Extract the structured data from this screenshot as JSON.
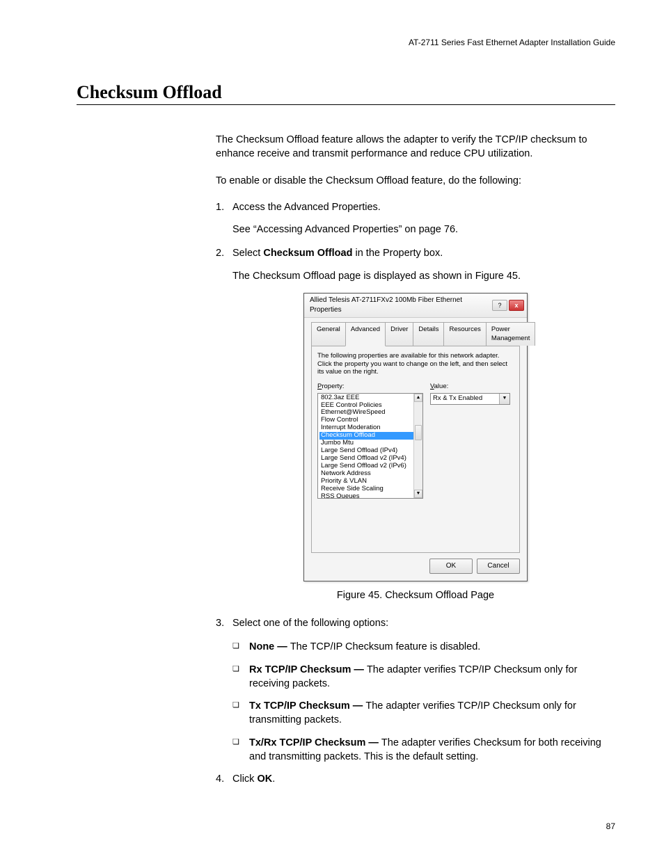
{
  "header": "AT-2711 Series Fast Ethernet Adapter Installation Guide",
  "section_title": "Checksum Offload",
  "intro_para": "The Checksum Offload feature allows the adapter to verify the TCP/IP checksum to enhance receive and transmit performance and reduce CPU utilization.",
  "enable_para": "To enable or disable the Checksum Offload feature, do the following:",
  "step1_num": "1.",
  "step1_text": "Access the Advanced Properties.",
  "step1_sub": "See “Accessing Advanced Properties” on page 76.",
  "step2_num": "2.",
  "step2_text_pre": "Select ",
  "step2_bold": "Checksum Offload",
  "step2_text_post": " in the Property box.",
  "step2_sub": "The Checksum Offload page is displayed as shown in Figure 45.",
  "figure_caption": "Figure 45. Checksum Offload Page",
  "step3_num": "3.",
  "step3_text": "Select one of the following options:",
  "options": {
    "none_bold": "None — ",
    "none_text": "The TCP/IP Checksum feature is disabled.",
    "rx_bold": "Rx TCP/IP Checksum — ",
    "rx_text": "The adapter verifies TCP/IP Checksum only for receiving packets.",
    "tx_bold": "Tx TCP/IP Checksum — ",
    "tx_text": "The adapter verifies TCP/IP Checksum only for transmitting packets.",
    "txrx_bold": "Tx/Rx TCP/IP Checksum — ",
    "txrx_text": "The adapter verifies Checksum for both receiving and transmitting packets. This is the default setting."
  },
  "step4_num": "4.",
  "step4_pre": "Click ",
  "step4_bold": "OK",
  "step4_post": ".",
  "page_num": "87",
  "dialog": {
    "title": "Allied Telesis AT-2711FXv2 100Mb Fiber Ethernet Properties",
    "help_glyph": "?",
    "close_glyph": "x",
    "tabs": {
      "general": "General",
      "advanced": "Advanced",
      "driver": "Driver",
      "details": "Details",
      "resources": "Resources",
      "power": "Power Management"
    },
    "instruction": "The following properties are available for this network adapter. Click the property you want to change on the left, and then select its value on the right.",
    "property_label": "Property:",
    "value_label": "Value:",
    "property_items": [
      "802.3az EEE",
      "EEE Control Policies",
      "Ethernet@WireSpeed",
      "Flow Control",
      "Interrupt Moderation",
      "Checksum Offload",
      "Jumbo Mtu",
      "Large Send Offload (IPv4)",
      "Large Send Offload v2 (IPv4)",
      "Large Send Offload v2 (IPv6)",
      "Network Address",
      "Priority & VLAN",
      "Receive Side Scaling",
      "RSS Queues"
    ],
    "selected_index": 5,
    "value_text": "Rx & Tx Enabled",
    "ok_btn": "OK",
    "cancel_btn": "Cancel",
    "scroll_up": "▲",
    "scroll_down": "▼",
    "dropdown_arrow": "▼"
  },
  "bullet_marker": "❏"
}
